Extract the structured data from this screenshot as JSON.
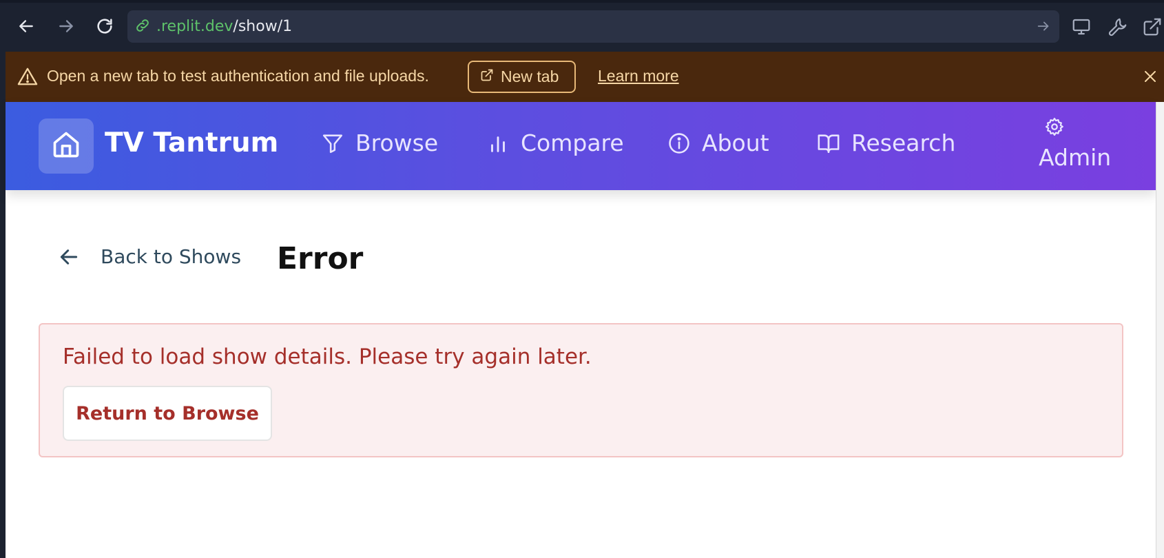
{
  "browser": {
    "url_domain": ".replit.dev",
    "url_path": "/show/1",
    "icons": [
      "back-arrow-icon",
      "forward-arrow-icon",
      "reload-icon",
      "link-icon",
      "go-arrow-icon",
      "monitor-icon",
      "wrench-icon",
      "external-link-icon"
    ]
  },
  "banner": {
    "message": "Open a new tab to test authentication and file uploads.",
    "new_tab_label": "New tab",
    "learn_more_label": "Learn more",
    "colors": {
      "background": "#4a280d",
      "text": "#f6d7a6"
    }
  },
  "header": {
    "brand": "TV Tantrum",
    "nav": [
      {
        "label": "Browse",
        "icon": "filter-icon"
      },
      {
        "label": "Compare",
        "icon": "bar-chart-icon"
      },
      {
        "label": "About",
        "icon": "info-icon"
      },
      {
        "label": "Research",
        "icon": "book-icon"
      }
    ],
    "admin_label": "Admin",
    "colors": {
      "gradient_start": "#3b5ce0",
      "gradient_end": "#7a3fe0"
    }
  },
  "main": {
    "back_label": "Back to Shows",
    "title": "Error",
    "error_message": "Failed to load show details. Please try again later.",
    "return_button_label": "Return to Browse",
    "colors": {
      "error_text": "#a52f2a",
      "error_bg": "#fbeff0",
      "error_border": "#f3c4c4"
    }
  }
}
